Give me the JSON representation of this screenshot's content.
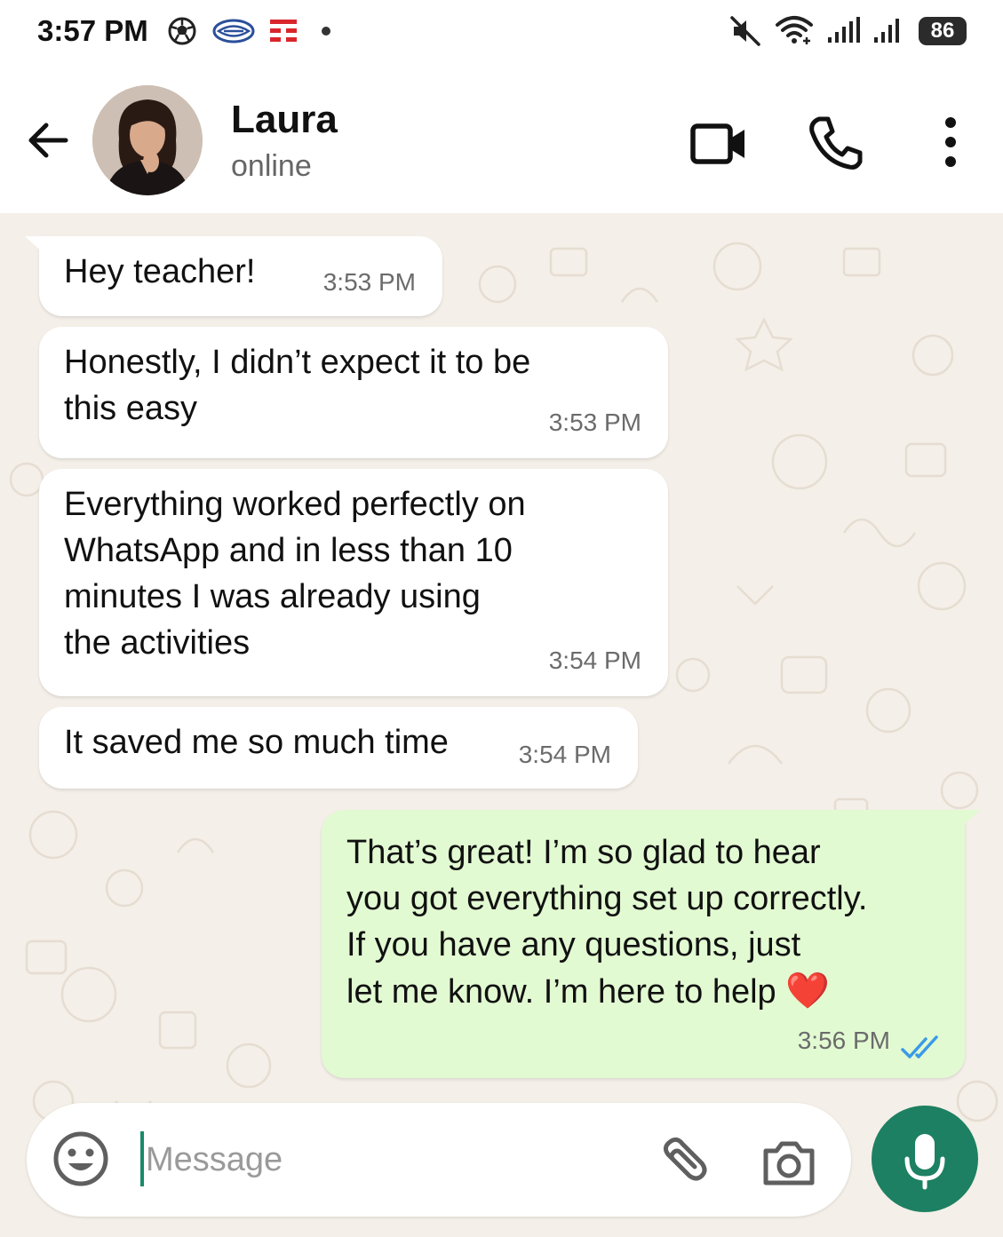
{
  "status_bar": {
    "time": "3:57 PM",
    "battery": "86",
    "icons": [
      "soccer-ball-icon",
      "app-notification-icon",
      "app-notification-icon-red",
      "dot-icon",
      "mute-icon",
      "wifi-icon",
      "signal-icon",
      "signal-icon"
    ]
  },
  "header": {
    "contact_name": "Laura",
    "contact_status": "online",
    "icons": [
      "back-arrow-icon",
      "video-call-icon",
      "phone-icon",
      "more-vert-icon"
    ]
  },
  "messages": [
    {
      "direction": "in",
      "text": "Hey teacher!",
      "time": "3:53 PM"
    },
    {
      "direction": "in",
      "text": "Honestly, I didn’t expect it to be\nthis easy",
      "time": "3:53 PM"
    },
    {
      "direction": "in",
      "text": "Everything worked perfectly on\nWhatsApp and in less than 10\nminutes I was already using\nthe activities",
      "time": "3:54 PM"
    },
    {
      "direction": "in",
      "text": "It saved me so much time",
      "time": "3:54 PM"
    },
    {
      "direction": "out",
      "text": "That’s great! I’m so glad to hear\nyou got everything set up correctly.\nIf you have any questions, just\nlet me know. I’m here to help ",
      "emoji": "❤️",
      "time": "3:56 PM",
      "status": "read"
    }
  ],
  "composer": {
    "placeholder": "Message",
    "value": ""
  },
  "colors": {
    "chat_bg": "#f4efe8",
    "incoming_bubble": "#ffffff",
    "outgoing_bubble": "#e2fad2",
    "accent": "#1d8062",
    "read_ticks": "#3a9be6"
  }
}
